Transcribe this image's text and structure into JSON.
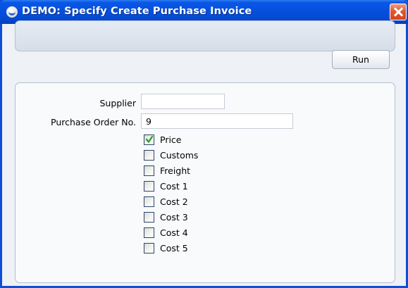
{
  "window": {
    "title": "DEMO: Specify Create Purchase Invoice",
    "title_bar_color": "#0650de",
    "close_button_color": "#e4552f"
  },
  "icons": {
    "app": "app-logo-icon",
    "close": "close-icon",
    "check": "checkmark-icon"
  },
  "toolbar": {
    "run_label": "Run"
  },
  "form": {
    "supplier": {
      "label": "Supplier",
      "value": ""
    },
    "purchase_order": {
      "label": "Purchase Order No.",
      "value": "9"
    },
    "checkboxes": [
      {
        "label": "Price",
        "checked": true
      },
      {
        "label": "Customs",
        "checked": false
      },
      {
        "label": "Freight",
        "checked": false
      },
      {
        "label": "Cost 1",
        "checked": false
      },
      {
        "label": "Cost 2",
        "checked": false
      },
      {
        "label": "Cost 3",
        "checked": false
      },
      {
        "label": "Cost 4",
        "checked": false
      },
      {
        "label": "Cost 5",
        "checked": false
      }
    ]
  }
}
